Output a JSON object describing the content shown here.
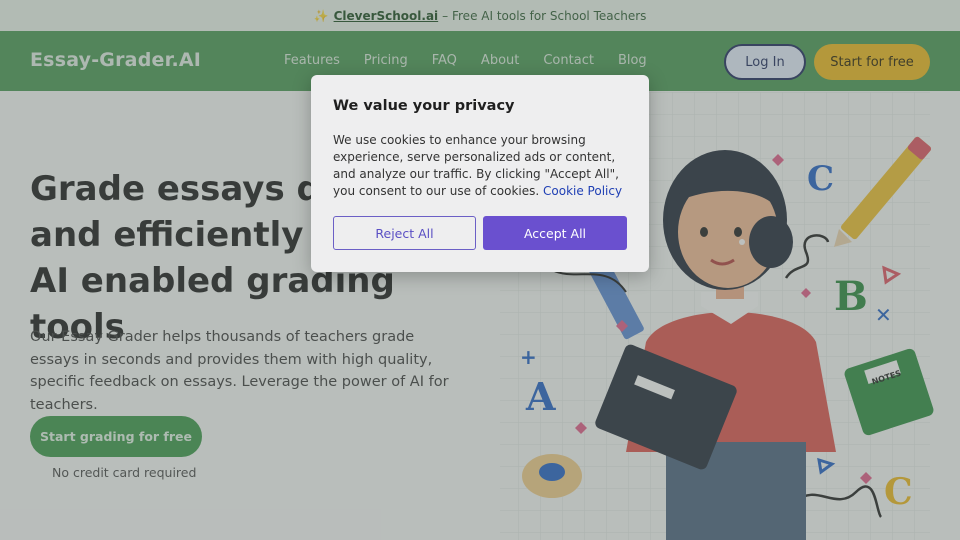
{
  "announcement": {
    "icon": "sparkle-icon",
    "link_text": "CleverSchool.ai",
    "rest_text": "– Free AI tools for School Teachers"
  },
  "navbar": {
    "logo": "Essay-Grader.AI",
    "links": [
      "Features",
      "Pricing",
      "FAQ",
      "About",
      "Contact",
      "Blog"
    ],
    "login_label": "Log In",
    "start_label": "Start for free"
  },
  "hero": {
    "title": "Grade essays quickly and efficiently using our AI enabled grading tools",
    "subtitle": "Our Essay Grader helps thousands of teachers grade essays in seconds and provides them with high quality, specific feedback on essays. Leverage the power of AI for teachers.",
    "cta_label": "Start grading for free",
    "cta_note": "No credit card required"
  },
  "cookie_modal": {
    "title": "We value your privacy",
    "body": "We use cookies to enhance your browsing experience, serve personalized ads or content, and analyze our traffic. By clicking \"Accept All\", you consent to our use of cookies.",
    "policy_link": "Cookie Policy",
    "reject_label": "Reject All",
    "accept_label": "Accept All"
  },
  "illustration": {
    "letters": [
      "C",
      "B",
      "A",
      "C"
    ],
    "notebook_label": "NOTES"
  },
  "colors": {
    "nav_green": "#4a9a55",
    "cta_green": "#3d9a4b",
    "start_yellow": "#f2bb1e",
    "accept_purple": "#6a50cf"
  }
}
